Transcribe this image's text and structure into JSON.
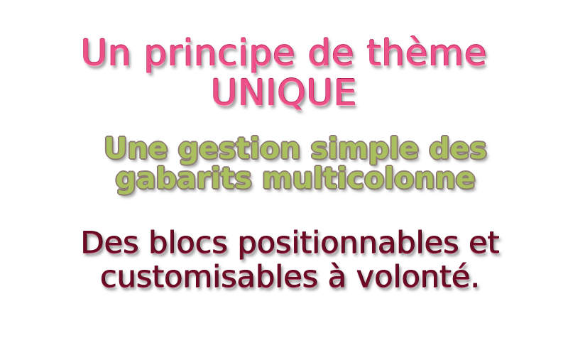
{
  "heading_1": {
    "line_1": "Un principe de thème",
    "line_2": "UNIQUE",
    "color": "#ee4f86"
  },
  "heading_2": {
    "line_1": "Une gestion simple des",
    "line_2": "gabarits multicolonne",
    "color": "#aabf5e"
  },
  "heading_3": {
    "line_1": "Des blocs positionnables et",
    "line_2": "customisables à volonté.",
    "color": "#6d0b25"
  }
}
